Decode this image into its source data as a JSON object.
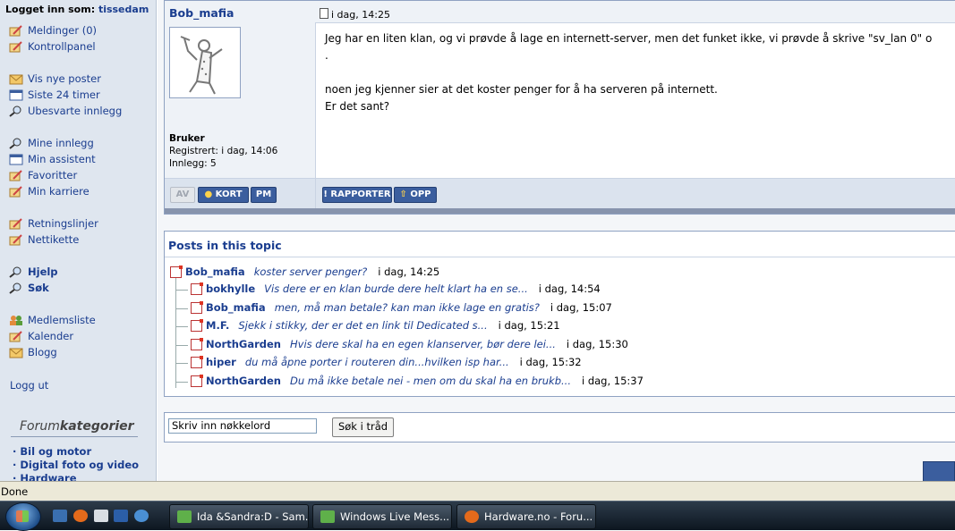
{
  "sidebar": {
    "logged_in_label": "Logget inn som:",
    "username": "tissedam",
    "items": [
      {
        "label": "Meldinger (0)",
        "icon": "pencil-icon"
      },
      {
        "label": "Kontrollpanel",
        "icon": "pencil-icon"
      },
      {
        "label": "Vis nye poster",
        "icon": "envelope-icon"
      },
      {
        "label": "Siste 24 timer",
        "icon": "calendar-icon"
      },
      {
        "label": "Ubesvarte innlegg",
        "icon": "magnifier-icon"
      },
      {
        "label": "Mine innlegg",
        "icon": "magnifier-icon"
      },
      {
        "label": "Min assistent",
        "icon": "calendar-icon"
      },
      {
        "label": "Favoritter",
        "icon": "pencil-icon"
      },
      {
        "label": "Min karriere",
        "icon": "pencil-icon"
      },
      {
        "label": "Retningslinjer",
        "icon": "pencil-icon"
      },
      {
        "label": "Nettikette",
        "icon": "pencil-icon"
      },
      {
        "label": "Hjelp",
        "icon": "magnifier-icon"
      },
      {
        "label": "Søk",
        "icon": "magnifier-icon"
      },
      {
        "label": "Medlemsliste",
        "icon": "users-icon"
      },
      {
        "label": "Kalender",
        "icon": "pencil-icon"
      },
      {
        "label": "Blogg",
        "icon": "envelope-icon"
      },
      {
        "label": "Logg ut",
        "icon": ""
      }
    ],
    "categories_title_a": "Forum",
    "categories_title_b": "kategorier",
    "categories": [
      "· Bil og motor",
      "· Digital foto og video",
      "· Hardware"
    ]
  },
  "post": {
    "author": "Bob_mafia",
    "date": "i dag, 14:25",
    "rank": "Bruker",
    "registered": "Registrert: i dag, 14:06",
    "posts": "Innlegg: 5",
    "lines": [
      "Jeg har en liten klan, og vi prøvde å lage en internett-server, men det funket ikke, vi prøvde å skrive \"sv_lan 0\" o",
      ".",
      "",
      "noen jeg kjenner sier at det koster penger for å ha serveren på internett.",
      "Er det sant?"
    ],
    "buttons": {
      "av": "AV",
      "kort": "KORT",
      "pm": "PM",
      "rapporter": "RAPPORTER",
      "opp": "OPP"
    }
  },
  "topics": {
    "title": "Posts in this topic",
    "rows": [
      {
        "author": "Bob_mafia",
        "snippet": "koster server penger?",
        "date": "i dag, 14:25"
      },
      {
        "author": "bokhylle",
        "snippet": "Vis dere er en klan burde dere helt klart ha en se...",
        "date": "i dag, 14:54"
      },
      {
        "author": "Bob_mafia",
        "snippet": "men, må man betale? kan man ikke lage en gratis?",
        "date": "i dag, 15:07"
      },
      {
        "author": "M.F.",
        "snippet": "Sjekk i stikky, der er det en link til Dedicated s...",
        "date": "i dag, 15:21"
      },
      {
        "author": "NorthGarden",
        "snippet": "Hvis dere skal ha en egen klanserver, bør dere lei...",
        "date": "i dag, 15:30"
      },
      {
        "author": "hiper",
        "snippet": "du må åpne porter i routeren din...hvilken isp har...",
        "date": "i dag, 15:32"
      },
      {
        "author": "NorthGarden",
        "snippet": "Du må ikke betale nei - men om du skal ha en brukb...",
        "date": "i dag, 15:37"
      }
    ]
  },
  "search": {
    "value": "Skriv inn nøkkelord",
    "button": "Søk i tråd"
  },
  "status": "Done",
  "taskbar": {
    "tasks": [
      "Ida &Sandra:D - Sam...",
      "Windows Live Mess...",
      "Hardware.no - Foru..."
    ]
  }
}
